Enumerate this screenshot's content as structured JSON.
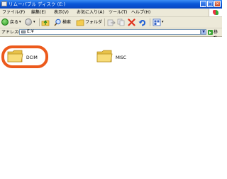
{
  "window": {
    "title": "リムーバブル ディスク (E:)"
  },
  "title_buttons": {
    "minimize": "_",
    "maximize": "□",
    "close": "×"
  },
  "menu": [
    {
      "label": "ファイル(F)"
    },
    {
      "label": "編集(E)"
    },
    {
      "label": "表示(V)"
    },
    {
      "label": "お気に入り(A)"
    },
    {
      "label": "ツール(T)"
    },
    {
      "label": "ヘルプ(H)"
    }
  ],
  "toolbar": {
    "back_label": "戻る",
    "search_label": "検索",
    "folders_label": "フォルダ"
  },
  "address": {
    "label": "アドレス(D)",
    "value": "E:¥",
    "go_label": "移動"
  },
  "folders": [
    {
      "name": "DCIM"
    },
    {
      "name": "MISC"
    }
  ],
  "colors": {
    "titlebar": "#0a58d8",
    "highlight": "#ec5a1c",
    "folder": "#f5d66c"
  }
}
